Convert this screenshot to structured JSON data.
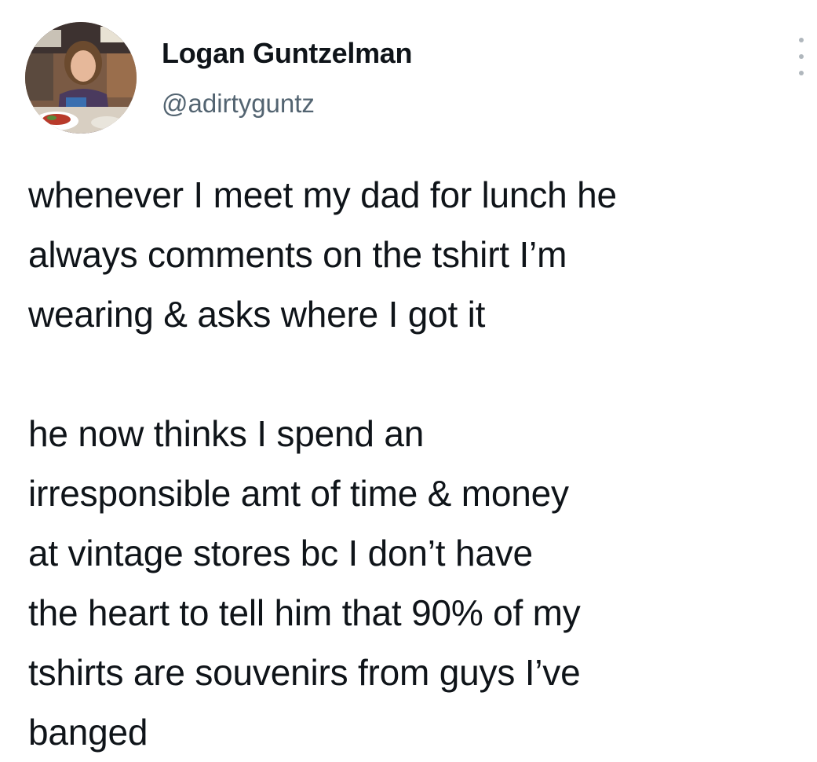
{
  "tweet": {
    "author": {
      "display_name": "Logan Guntzelman",
      "handle": "@adirtyguntz",
      "avatar_icon": "profile-photo"
    },
    "more_icon": "vertical-ellipsis-icon",
    "paragraphs": [
      "whenever I meet my dad for lunch he\nalways comments on the tshirt I’m\nwearing & asks where I got it",
      "he now thinks I spend an\nirresponsible amt of time & money\nat vintage stores bc I don’t have\nthe heart to tell him that 90% of my\ntshirts are souvenirs from guys I’ve\nbanged"
    ]
  },
  "colors": {
    "text_primary": "#0f1419",
    "text_secondary": "#536471",
    "background": "#ffffff"
  }
}
